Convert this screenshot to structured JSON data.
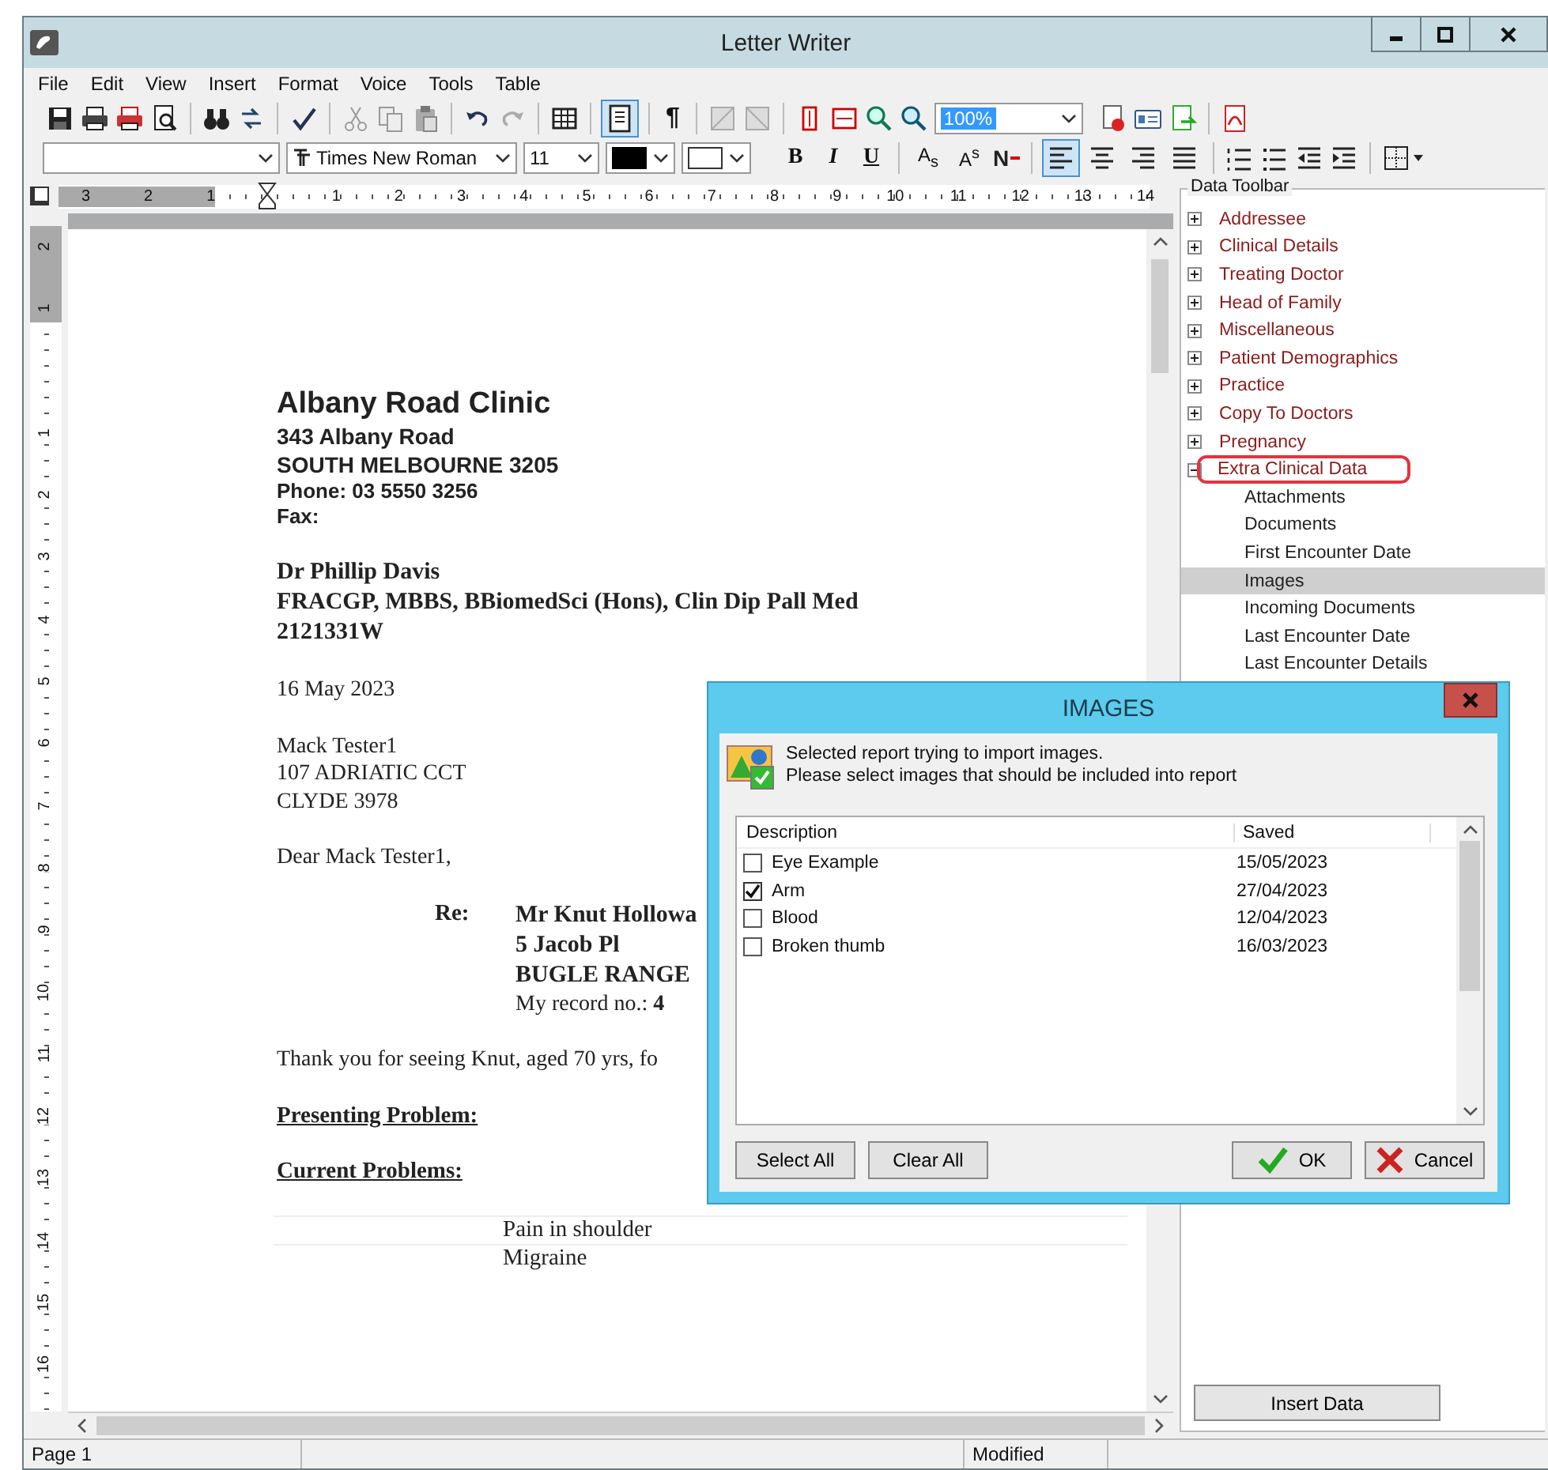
{
  "window": {
    "title": "Letter Writer"
  },
  "menu": [
    "File",
    "Edit",
    "View",
    "Insert",
    "Format",
    "Voice",
    "Tools",
    "Table"
  ],
  "toolbar": {
    "page_view_selected": true,
    "pilcrow": "¶",
    "zoom": "100%"
  },
  "format_bar": {
    "font": "Times New Roman",
    "size": "11",
    "bold": "B",
    "italic": "I",
    "underline": "U",
    "subscript": "A$_{s}$",
    "superscript": "A$^{s}$",
    "strike": "N",
    "alignment": [
      {
        "kind": "left",
        "selected": true
      },
      {
        "kind": "center",
        "selected": false
      },
      {
        "kind": "right",
        "selected": false
      },
      {
        "kind": "justify",
        "selected": false
      }
    ]
  },
  "ruler": {
    "h_ticks": [
      {
        "label": "3",
        "margin": true
      },
      {
        "label": "2",
        "margin": true
      },
      {
        "label": "1",
        "margin": true
      },
      {
        "label": "1",
        "margin": false
      },
      {
        "label": "2",
        "margin": false
      },
      {
        "label": "3",
        "margin": false
      },
      {
        "label": "4",
        "margin": false
      },
      {
        "label": "5",
        "margin": false
      },
      {
        "label": "6",
        "margin": false
      },
      {
        "label": "7",
        "margin": false
      },
      {
        "label": "8",
        "margin": false
      },
      {
        "label": "9",
        "margin": false
      },
      {
        "label": "10",
        "margin": false
      },
      {
        "label": "11",
        "margin": false
      },
      {
        "label": "12",
        "margin": false
      },
      {
        "label": "13",
        "margin": false
      },
      {
        "label": "14",
        "margin": false
      }
    ],
    "v_ticks": [
      {
        "label": "2",
        "margin": true
      },
      {
        "label": "1",
        "margin": true
      },
      {
        "label": "1",
        "margin": false
      },
      {
        "label": "2",
        "margin": false
      },
      {
        "label": "3",
        "margin": false
      },
      {
        "label": "4",
        "margin": false
      },
      {
        "label": "5",
        "margin": false
      },
      {
        "label": "6",
        "margin": false
      },
      {
        "label": "7",
        "margin": false
      },
      {
        "label": "8",
        "margin": false
      },
      {
        "label": "9",
        "margin": false
      },
      {
        "label": "10",
        "margin": false
      },
      {
        "label": "11",
        "margin": false
      },
      {
        "label": "12",
        "margin": false
      },
      {
        "label": "13",
        "margin": false
      },
      {
        "label": "14",
        "margin": false
      },
      {
        "label": "15",
        "margin": false
      },
      {
        "label": "16",
        "margin": false
      }
    ]
  },
  "letter": [
    {
      "kind": "block",
      "lines": [
        {
          "kind": "clinic",
          "text": "Albany Road Clinic"
        },
        {
          "kind": "sans_bold",
          "text": "343 Albany Road"
        },
        {
          "kind": "sans_bold",
          "text": "SOUTH MELBOURNE  3205"
        },
        {
          "kind": "sans_small",
          "text": "Phone: 03 5550 3256"
        },
        {
          "kind": "sans_small",
          "text": "Fax:"
        }
      ]
    },
    {
      "kind": "block",
      "lines": [
        {
          "kind": "serif_bold",
          "text": "Dr Phillip Davis"
        },
        {
          "kind": "serif_bold",
          "text": "FRACGP, MBBS, BBiomedSci (Hons), Clin Dip Pall Med"
        },
        {
          "kind": "serif_bold",
          "text": "2121331W"
        }
      ]
    },
    {
      "kind": "block",
      "lines": [
        {
          "kind": "serif",
          "text": "16 May 2023"
        }
      ]
    },
    {
      "kind": "block",
      "lines": [
        {
          "kind": "serif",
          "text": "Mack Tester1"
        },
        {
          "kind": "serif",
          "text": "107 ADRIATIC CCT"
        },
        {
          "kind": "serif",
          "text": "CLYDE 3978"
        }
      ]
    },
    {
      "kind": "block",
      "lines": [
        {
          "kind": "serif",
          "text": "Dear Mack Tester1,"
        }
      ]
    },
    {
      "kind": "re",
      "label": "Re:",
      "lines": [
        {
          "kind": "serif_bold",
          "text": "Mr Knut Hollowa"
        },
        {
          "kind": "serif_bold",
          "text": "5 Jacob Pl"
        },
        {
          "kind": "serif_bold",
          "text": "BUGLE RANGE"
        },
        {
          "kind": "serif",
          "text": "My record no.: **4**"
        }
      ]
    },
    {
      "kind": "block",
      "lines": [
        {
          "kind": "serif",
          "text": "Thank you for seeing Knut, aged 70 yrs, fo"
        }
      ]
    },
    {
      "kind": "block",
      "lines": [
        {
          "kind": "heading",
          "text": "Presenting Problem:"
        }
      ]
    },
    {
      "kind": "block",
      "lines": [
        {
          "kind": "heading",
          "text": "Current Problems:"
        }
      ]
    },
    {
      "kind": "table",
      "rows": [
        "Pain in shoulder",
        "Migraine"
      ]
    }
  ],
  "data_toolbar": {
    "title": "Data Toolbar",
    "items": [
      {
        "label": "Addressee",
        "expanded": false,
        "selected": false,
        "annotated": false
      },
      {
        "label": "Clinical Details",
        "expanded": false,
        "selected": false,
        "annotated": false
      },
      {
        "label": "Treating Doctor",
        "expanded": false,
        "selected": false,
        "annotated": false
      },
      {
        "label": "Head of Family",
        "expanded": false,
        "selected": false,
        "annotated": false
      },
      {
        "label": "Miscellaneous",
        "expanded": false,
        "selected": false,
        "annotated": false
      },
      {
        "label": "Patient Demographics",
        "expanded": false,
        "selected": false,
        "annotated": false
      },
      {
        "label": "Practice",
        "expanded": false,
        "selected": false,
        "annotated": false
      },
      {
        "label": "Copy To Doctors",
        "expanded": false,
        "selected": false,
        "annotated": false
      },
      {
        "label": "Pregnancy",
        "expanded": false,
        "selected": false,
        "annotated": false
      },
      {
        "label": "Extra Clinical Data",
        "expanded": true,
        "selected": false,
        "annotated": true,
        "children": [
          {
            "label": "Attachments",
            "selected": false
          },
          {
            "label": "Documents",
            "selected": false
          },
          {
            "label": "First Encounter Date",
            "selected": false
          },
          {
            "label": "Images",
            "selected": true
          },
          {
            "label": "Incoming Documents",
            "selected": false
          },
          {
            "label": "Last Encounter Date",
            "selected": false
          },
          {
            "label": "Last Encounter Details",
            "selected": false
          }
        ]
      }
    ],
    "button": "Insert Data"
  },
  "status_bar": {
    "page": "Page 1",
    "state": "Modified"
  },
  "dialog": {
    "title": "IMAGES",
    "message": [
      "Selected report trying to import images.",
      "Please select images that should be included into report"
    ],
    "columns": [
      "Description",
      "Saved"
    ],
    "rows": [
      {
        "description": "Eye Example",
        "saved": "15/05/2023",
        "checked": false
      },
      {
        "description": "Arm",
        "saved": "27/04/2023",
        "checked": true
      },
      {
        "description": "Blood",
        "saved": "12/04/2023",
        "checked": false
      },
      {
        "description": "Broken thumb",
        "saved": "16/03/2023",
        "checked": false
      }
    ],
    "buttons": {
      "select_all": "Select All",
      "clear_all": "Clear All",
      "ok": "OK",
      "cancel": "Cancel"
    }
  }
}
